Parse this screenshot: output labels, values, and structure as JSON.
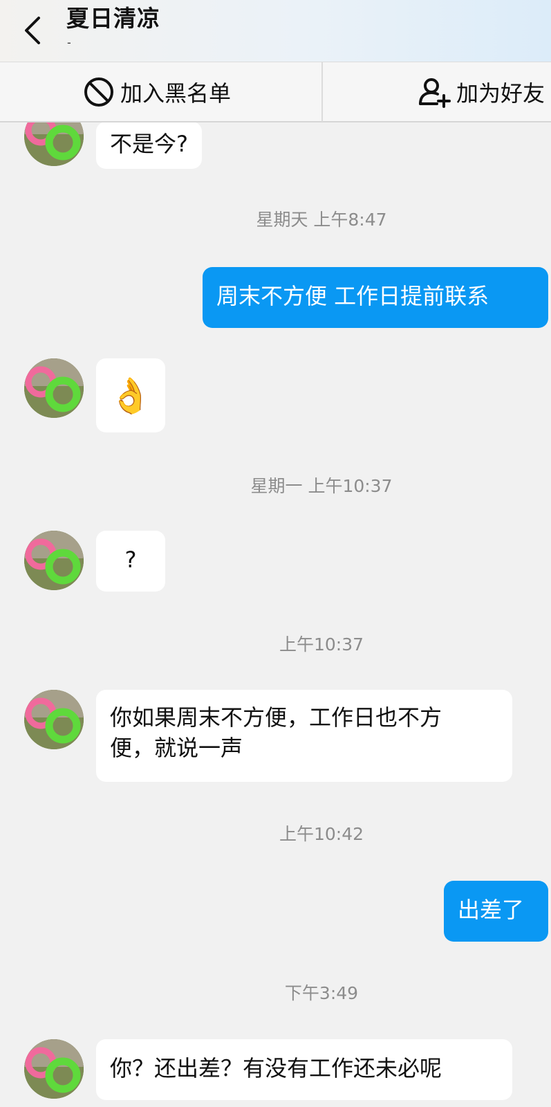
{
  "header": {
    "title": "夏日清凉",
    "subtitle": "-"
  },
  "actions": {
    "block_label": "加入黑名单",
    "add_friend_label": "加为好友"
  },
  "messages": [
    {
      "type": "text",
      "from": "other",
      "text": "不是今?"
    },
    {
      "type": "timestamp",
      "text": "星期天 上午8:47"
    },
    {
      "type": "text",
      "from": "me",
      "text": "周末不方便 工作日提前联系"
    },
    {
      "type": "emoji",
      "from": "other",
      "emoji": "👌"
    },
    {
      "type": "timestamp",
      "text": "星期一 上午10:37"
    },
    {
      "type": "text",
      "from": "other",
      "text": "?"
    },
    {
      "type": "timestamp",
      "text": "上午10:37"
    },
    {
      "type": "text",
      "from": "other",
      "lines": [
        "你如果周末不方便，工作日也不方",
        "便，就说一声"
      ]
    },
    {
      "type": "timestamp",
      "text": "上午10:42"
    },
    {
      "type": "text",
      "from": "me",
      "text": "出差了"
    },
    {
      "type": "timestamp",
      "text": "下午3:49"
    },
    {
      "type": "text",
      "from": "other",
      "text": "你？还出差？有没有工作还未必呢"
    }
  ],
  "colors": {
    "my_bubble": "#0a98f3",
    "other_bubble": "#ffffff",
    "background": "#f1f1f1"
  }
}
